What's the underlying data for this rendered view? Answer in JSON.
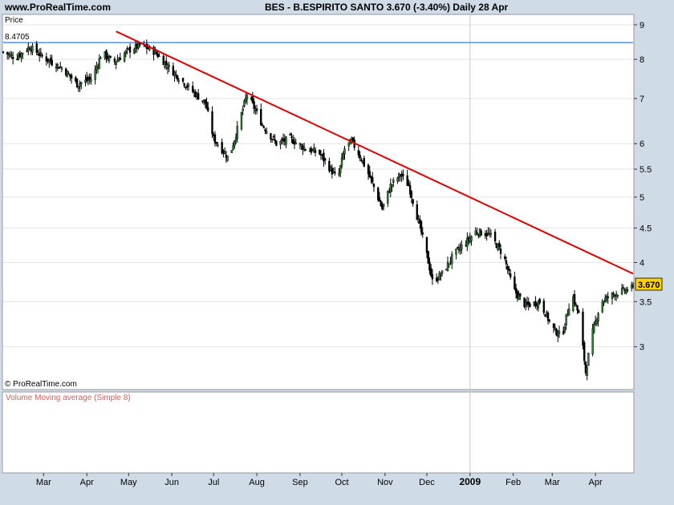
{
  "header": {
    "site": "www.ProRealTime.com",
    "title": "BES - B.ESPIRITO SANTO    3.670 (-3.40%)     Daily  28 Apr"
  },
  "price_panel": {
    "label": "Price",
    "ref_label": "8.4705",
    "copyright": "© ProRealTime.com",
    "last_value": "3.670"
  },
  "volume_panel": {
    "label": "Volume Moving average (Simple 8)"
  },
  "colors": {
    "background": "#cfdbe6",
    "panel": "#ffffff",
    "up_candle": "#2e7d32",
    "down_candle": "#000000",
    "trendline": "#e00000",
    "ref_line": "#5b8fd6",
    "last_price_box": "#ffd200"
  },
  "chart_data": {
    "type": "candlestick",
    "scale": "log",
    "x_range": [
      "2008-02-01",
      "2009-04-28"
    ],
    "ylim": [
      2.6,
      9.3
    ],
    "y_ticks": [
      3,
      3.5,
      4,
      4.5,
      5,
      5.5,
      6,
      7,
      8,
      9
    ],
    "x_ticks": [
      {
        "label": "Mar",
        "date": "2008-03-01"
      },
      {
        "label": "Apr",
        "date": "2008-04-01"
      },
      {
        "label": "May",
        "date": "2008-05-01"
      },
      {
        "label": "Jun",
        "date": "2008-06-01"
      },
      {
        "label": "Jul",
        "date": "2008-07-01"
      },
      {
        "label": "Aug",
        "date": "2008-08-01"
      },
      {
        "label": "Sep",
        "date": "2008-09-01"
      },
      {
        "label": "Oct",
        "date": "2008-10-01"
      },
      {
        "label": "Nov",
        "date": "2008-11-01"
      },
      {
        "label": "Dec",
        "date": "2008-12-01"
      },
      {
        "label": "2009",
        "date": "2009-01-01",
        "bold": true
      },
      {
        "label": "Feb",
        "date": "2009-02-01"
      },
      {
        "label": "Mar",
        "date": "2009-03-01"
      },
      {
        "label": "Apr",
        "date": "2009-04-01"
      }
    ],
    "reference_line": {
      "value": 8.4705
    },
    "trendline": {
      "start": [
        "2008-04-22",
        8.8
      ],
      "end": [
        "2009-04-28",
        3.85
      ]
    },
    "last_price": 3.67,
    "change_pct": -3.4,
    "close_series": [
      [
        "2008-02-01",
        8.2
      ],
      [
        "2008-02-10",
        8.05
      ],
      [
        "2008-02-20",
        8.35
      ],
      [
        "2008-03-01",
        8.05
      ],
      [
        "2008-03-15",
        7.75
      ],
      [
        "2008-03-25",
        7.35
      ],
      [
        "2008-04-05",
        7.5
      ],
      [
        "2008-04-12",
        8.2
      ],
      [
        "2008-04-20",
        7.9
      ],
      [
        "2008-05-01",
        8.25
      ],
      [
        "2008-05-10",
        8.4
      ],
      [
        "2008-05-20",
        8.2
      ],
      [
        "2008-06-01",
        7.7
      ],
      [
        "2008-06-15",
        7.2
      ],
      [
        "2008-06-25",
        6.9
      ],
      [
        "2008-07-01",
        6.1
      ],
      [
        "2008-07-12",
        5.7
      ],
      [
        "2008-07-18",
        6.3
      ],
      [
        "2008-07-25",
        7.1
      ],
      [
        "2008-08-05",
        6.4
      ],
      [
        "2008-08-15",
        6.0
      ],
      [
        "2008-08-25",
        6.1
      ],
      [
        "2008-09-05",
        5.9
      ],
      [
        "2008-09-15",
        5.8
      ],
      [
        "2008-09-28",
        5.3
      ],
      [
        "2008-10-03",
        5.9
      ],
      [
        "2008-10-08",
        6.05
      ],
      [
        "2008-10-15",
        5.7
      ],
      [
        "2008-10-22",
        5.3
      ],
      [
        "2008-10-30",
        4.8
      ],
      [
        "2008-11-05",
        5.2
      ],
      [
        "2008-11-12",
        5.4
      ],
      [
        "2008-11-18",
        5.2
      ],
      [
        "2008-11-25",
        4.6
      ],
      [
        "2008-12-01",
        4.1
      ],
      [
        "2008-12-05",
        3.75
      ],
      [
        "2008-12-12",
        3.85
      ],
      [
        "2008-12-20",
        4.1
      ],
      [
        "2009-01-01",
        4.35
      ],
      [
        "2009-01-05",
        4.45
      ],
      [
        "2009-01-15",
        4.4
      ],
      [
        "2009-01-25",
        4.1
      ],
      [
        "2009-02-01",
        3.65
      ],
      [
        "2009-02-10",
        3.45
      ],
      [
        "2009-02-20",
        3.5
      ],
      [
        "2009-03-01",
        3.2
      ],
      [
        "2009-03-08",
        3.1
      ],
      [
        "2009-03-15",
        3.6
      ],
      [
        "2009-03-20",
        3.35
      ],
      [
        "2009-03-25",
        2.75
      ],
      [
        "2009-03-30",
        3.15
      ],
      [
        "2009-04-05",
        3.5
      ],
      [
        "2009-04-15",
        3.6
      ],
      [
        "2009-04-28",
        3.67
      ]
    ]
  }
}
